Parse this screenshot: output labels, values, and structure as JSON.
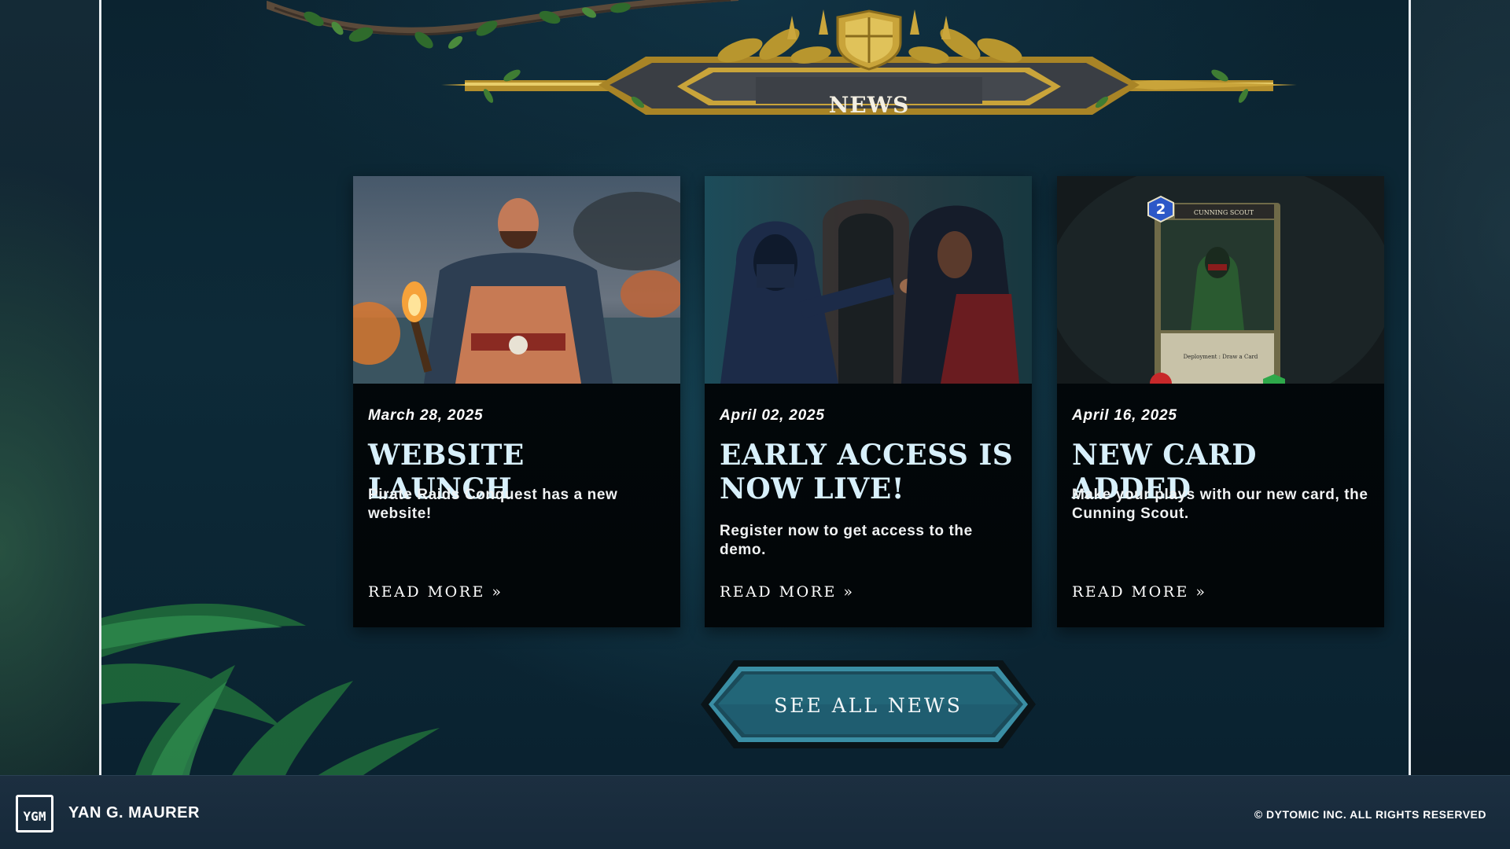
{
  "header": {
    "title": "NEWS"
  },
  "news": [
    {
      "date": "March 28, 2025",
      "title": "WEBSITE LAUNCH",
      "description": "Pirate Raids Conquest has a new website!",
      "link": "READ MORE »"
    },
    {
      "date": "April 02, 2025",
      "title": "EARLY ACCESS IS NOW LIVE!",
      "description": "Register now to get access to the demo.",
      "link": "READ MORE »"
    },
    {
      "date": "April 16, 2025",
      "title": "NEW CARD ADDED",
      "description": "Make your plays with our new card, the Cunning Scout.",
      "link": "READ MORE »",
      "card_art": {
        "name": "CUNNING SCOUT",
        "cost": "2",
        "ability": "Deployment : Draw a Card"
      }
    }
  ],
  "cta": {
    "label": "SEE ALL NEWS"
  },
  "footer": {
    "logo_text": "YGM",
    "name": "YAN G. MAURER",
    "copyright": "© DYTOMIC INC. ALL RIGHTS RESERVED"
  },
  "colors": {
    "accent_gold": "#c9a43a",
    "card_title": "#d8f0fb",
    "button_teal": "#1f5d70",
    "frame_border": "#e9eef2"
  }
}
